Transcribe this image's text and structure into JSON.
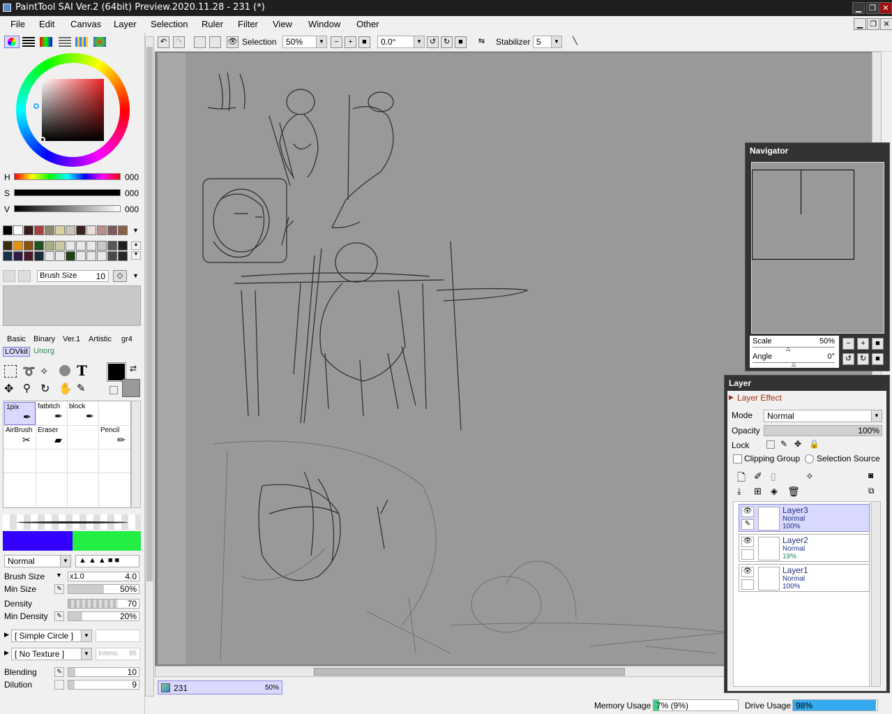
{
  "window": {
    "title": "PaintTool SAI Ver.2 (64bit) Preview.2020.11.28 - 231 (*)"
  },
  "menu": [
    "File",
    "Edit",
    "Canvas",
    "Layer",
    "Selection",
    "Ruler",
    "Filter",
    "View",
    "Window",
    "Other"
  ],
  "toolbar": {
    "selection_label": "Selection",
    "zoom": "50%",
    "angle": "0.0°",
    "stabilizer_label": "Stabilizer",
    "stabilizer_value": "5"
  },
  "color": {
    "h_label": "H",
    "s_label": "S",
    "v_label": "V",
    "h_value": "000",
    "s_value": "000",
    "v_value": "000"
  },
  "brush_size_field": {
    "label": "Brush Size",
    "value": "10"
  },
  "tool_tabs": [
    "Basic",
    "Binary",
    "Ver.1",
    "Artistic",
    "gr4",
    "LOVkit",
    "Unorg"
  ],
  "brushes": [
    {
      "name": "1pix",
      "selected": true
    },
    {
      "name": "fatbitch"
    },
    {
      "name": "block"
    },
    {
      "name": "AirBrush"
    },
    {
      "name": "Eraser"
    },
    {
      "name": ""
    },
    {
      "name": "Pencil"
    }
  ],
  "brush_settings": {
    "mode": "Normal",
    "brush_size_label": "Brush Size",
    "brush_size_mult": "x1.0",
    "brush_size_value": "4.0",
    "min_size_label": "Min Size",
    "min_size_value": "50%",
    "density_label": "Density",
    "density_value": "70",
    "min_density_label": "Min Density",
    "min_density_value": "20%",
    "shape": "[ Simple Circle ]",
    "texture": "[ No Texture ]",
    "intens_label": "Intens.",
    "intens_value": "95",
    "blending_label": "Blending",
    "blending_value": "10",
    "dilution_label": "Dilution",
    "dilution_value": "9"
  },
  "colors": {
    "main_blue": "#3300ff",
    "main_green": "#22ee44",
    "accent": "#d9d9ff"
  },
  "document_tab": {
    "name": "231",
    "zoom": "50%"
  },
  "navigator": {
    "title": "Navigator",
    "scale_label": "Scale",
    "scale_value": "50%",
    "angle_label": "Angle",
    "angle_value": "0°"
  },
  "layer_panel": {
    "title": "Layer",
    "effect_label": "Layer Effect",
    "mode_label": "Mode",
    "mode_value": "Normal",
    "opacity_label": "Opacity",
    "opacity_value": "100%",
    "lock_label": "Lock",
    "clipping_label": "Clipping Group",
    "selection_source_label": "Selection Source",
    "layers": [
      {
        "name": "Layer3",
        "mode": "Normal",
        "opacity": "100%",
        "selected": true
      },
      {
        "name": "Layer2",
        "mode": "Normal",
        "opacity": "19%"
      },
      {
        "name": "Layer1",
        "mode": "Normal",
        "opacity": "100%"
      }
    ]
  },
  "status": {
    "memory_label": "Memory Usage",
    "memory_value": "7% (9%)",
    "memory_fraction": 0.07,
    "drive_label": "Drive Usage",
    "drive_value": "98%",
    "drive_fraction": 0.98
  }
}
